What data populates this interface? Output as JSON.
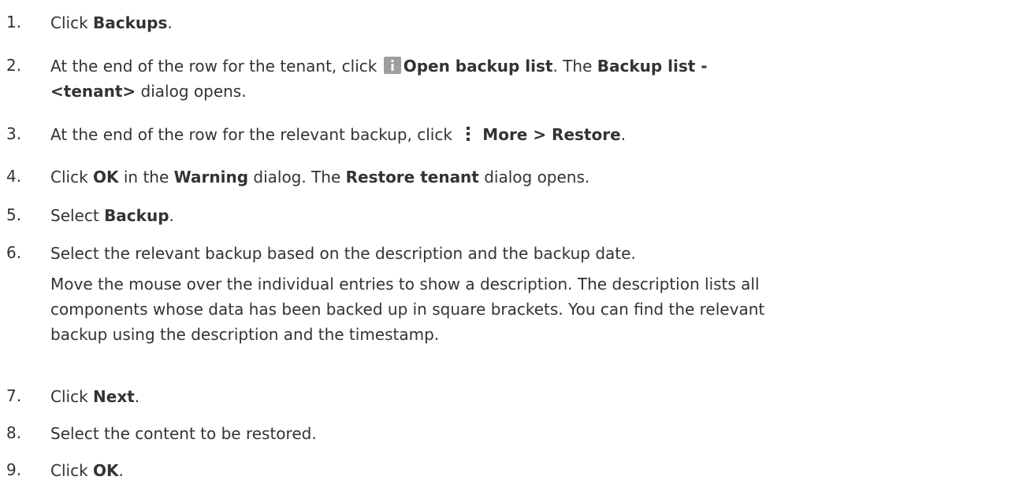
{
  "steps": [
    {
      "num": "1.",
      "t1": "Click ",
      "b1": "Backups",
      "t2": "."
    },
    {
      "num": "2.",
      "t1": "At the end of the row for the tenant, click ",
      "icon": "info-icon",
      "b1": "Open backup list",
      "t2": ". The ",
      "b2": "Backup list -",
      "b3": "<tenant>",
      "t3": " dialog opens."
    },
    {
      "num": "3.",
      "t1": "At the end of the row for the relevant backup, click ",
      "icon": "more-vertical-icon",
      "b1": "More > Restore",
      "t2": "."
    },
    {
      "num": "4.",
      "t1": "Click ",
      "b1": "OK",
      "t2": " in the ",
      "b2": "Warning",
      "t3": " dialog. The ",
      "b3": "Restore tenant",
      "t4": " dialog opens."
    },
    {
      "num": "5.",
      "t1": "Select ",
      "b1": "Backup",
      "t2": "."
    },
    {
      "num": "6.",
      "t1": "Select the relevant backup based on the description and the backup date.",
      "note1": "Move the mouse over the individual entries to show a description. The description lists all",
      "note2": "components whose data has been backed up in square brackets. You can find the relevant",
      "note3": "backup using the description and the timestamp."
    },
    {
      "num": "7.",
      "t1": "Click ",
      "b1": "Next",
      "t2": "."
    },
    {
      "num": "8.",
      "t1": "Select the content to be restored."
    },
    {
      "num": "9.",
      "t1": "Click ",
      "b1": "OK",
      "t2": "."
    }
  ],
  "colors": {
    "text": "#333333",
    "icon": "#9e9e9e"
  }
}
